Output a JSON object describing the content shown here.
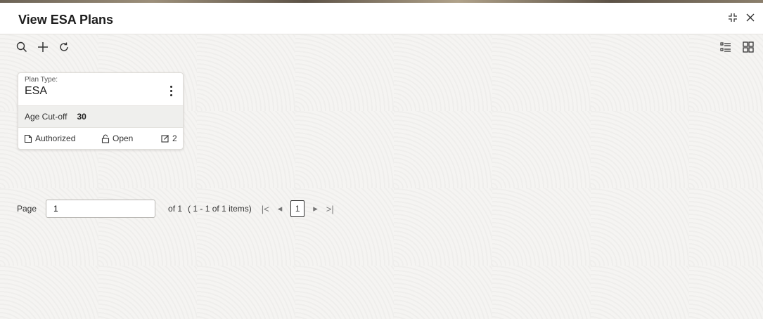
{
  "header": {
    "title": "View ESA Plans"
  },
  "toolbar": {
    "search_icon": "search-icon",
    "add_icon": "add-icon",
    "refresh_icon": "refresh-icon"
  },
  "card": {
    "plan_type_label": "Plan Type:",
    "plan_type_value": "ESA",
    "age_cutoff_label": "Age Cut-off",
    "age_cutoff_value": "30",
    "status_authorized": "Authorized",
    "status_open": "Open",
    "edit_count": "2"
  },
  "pager": {
    "page_label": "Page",
    "page_value": "1",
    "of_text": "of 1",
    "items_text": "( 1 - 1 of 1 items)",
    "current_page": "1"
  }
}
